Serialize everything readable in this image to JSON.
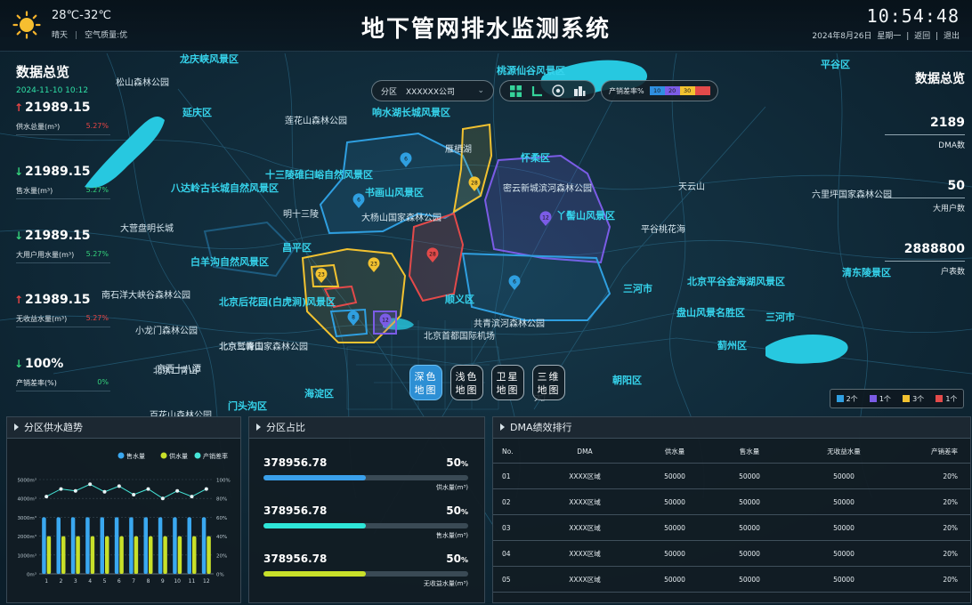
{
  "header": {
    "temperature": "28℃-32℃",
    "weather": "晴天",
    "air_quality": "空气质量:优",
    "title": "地下管网排水监测系统",
    "clock": "10:54:48",
    "date": "2024年8月26日",
    "weekday": "星期一",
    "back_label": "返回",
    "exit_label": "退出",
    "sun_icon": "sun-icon"
  },
  "left_panel": {
    "title": "数据总览",
    "date": "2024-11-10 10:12",
    "stats": [
      {
        "value": "21989.15",
        "label": "供水总量(m³)",
        "pct": "5.27%",
        "trend": "up"
      },
      {
        "value": "21989.15",
        "label": "售水量(m³)",
        "pct": "5.27%",
        "trend": "down"
      },
      {
        "value": "21989.15",
        "label": "大用户用水量(m³)",
        "pct": "5.27%",
        "trend": "down"
      },
      {
        "value": "21989.15",
        "label": "无收益水量(m³)",
        "pct": "5.27%",
        "trend": "up"
      },
      {
        "value": "100%",
        "label": "产销差率(%)",
        "pct": "0%",
        "trend": "down"
      }
    ]
  },
  "right_panel": {
    "title": "数据总览",
    "stats": [
      {
        "value": "2189",
        "label": "DMA数"
      },
      {
        "value": "50",
        "label": "大用户数"
      },
      {
        "value": "2888800",
        "label": "户表数"
      }
    ]
  },
  "toolbar": {
    "district_label": "分区",
    "district_value": "XXXXXX公司",
    "ratio_label": "产销差率%",
    "ratio_scale": [
      {
        "label": "10",
        "color": "#2f8fe0"
      },
      {
        "label": "20",
        "color": "#7b5ce6"
      },
      {
        "label": "30",
        "color": "#f2c230"
      },
      {
        "label": "",
        "color": "#e34a4a"
      }
    ]
  },
  "map": {
    "labels": [
      "龙庆峡风景区",
      "松山森林公园",
      "延庆区",
      "莲花山森林公园",
      "响水湖长城风景区",
      "桃源仙谷风景区",
      "怀柔区",
      "平谷区",
      "雁栖湖",
      "十三陵碓臼峪自然风景区",
      "八达岭古长城自然风景区",
      "书画山风景区",
      "密云新城滨河森林公园",
      "天云山",
      "大杨山国家森林公园",
      "丫髻山风景区",
      "明十三陵",
      "昌平区",
      "六里坪国家森林公园",
      "大营盘明长城",
      "平谷桃花海",
      "白羊沟自然风景区",
      "顺义区",
      "北京平谷金海湖风景区",
      "清东陵景区",
      "南石洋大峡谷森林公园",
      "北京后花园(白虎涧)风景区",
      "共青滨河森林公园",
      "北京首都国际机场",
      "盘山风景名胜区",
      "小龙门森林公园",
      "北京鹫峰国家森林公园",
      "北京二青山",
      "百花山森林公园",
      "门头沟区",
      "海淀区",
      "朝阳区",
      "大厂",
      "蓟州区",
      "三河市",
      "京西十八潭",
      "北京二青山",
      "三河市",
      "京西十八潭",
      "北京二青山"
    ],
    "markers": [
      "6",
      "6",
      "28",
      "12",
      "23",
      "23",
      "28",
      "8",
      "12",
      "6"
    ],
    "style_buttons": [
      {
        "label_top": "深色",
        "label_bottom": "地图",
        "active": true
      },
      {
        "label_top": "浅色",
        "label_bottom": "地图",
        "active": false
      },
      {
        "label_top": "卫星",
        "label_bottom": "地图",
        "active": false
      },
      {
        "label_top": "三维",
        "label_bottom": "地图",
        "active": false
      }
    ],
    "count_legend": [
      {
        "color": "#2f9fe0",
        "label": "2个"
      },
      {
        "color": "#7b5ce6",
        "label": "1个"
      },
      {
        "color": "#f2c230",
        "label": "3个"
      },
      {
        "color": "#e34a4a",
        "label": "1个"
      }
    ]
  },
  "panels": {
    "trend_title": "分区供水趋势",
    "proportion_title": "分区占比",
    "ranking_title": "DMA绩效排行"
  },
  "chart_data": {
    "type": "bar",
    "title": "分区供水趋势",
    "categories": [
      "1",
      "2",
      "3",
      "4",
      "5",
      "6",
      "7",
      "8",
      "9",
      "10",
      "11",
      "12"
    ],
    "series": [
      {
        "name": "售水量",
        "type": "bar",
        "color": "#3aa8f0",
        "values": [
          3000,
          3000,
          3000,
          3000,
          3000,
          3000,
          3000,
          3000,
          3000,
          3000,
          3000,
          3000
        ]
      },
      {
        "name": "供水量",
        "type": "bar",
        "color": "#c8e02a",
        "values": [
          2000,
          2000,
          2000,
          2000,
          2000,
          2000,
          2000,
          2000,
          2000,
          2000,
          2000,
          2000
        ]
      },
      {
        "name": "产销差率",
        "type": "line",
        "color": "#46e6d8",
        "axis": "right",
        "values": [
          82,
          90,
          88,
          95,
          87,
          93,
          84,
          90,
          80,
          88,
          82,
          90
        ]
      }
    ],
    "left_ticks": [
      "0m³",
      "1000m³",
      "2000m³",
      "3000m³",
      "4000m³",
      "5000m³"
    ],
    "right_ticks": [
      "0%",
      "20%",
      "40%",
      "60%",
      "80%",
      "100%"
    ],
    "ylim_left": [
      0,
      5000
    ],
    "ylim_right": [
      0,
      100
    ],
    "legend_position": "top-right",
    "grid": true
  },
  "proportion": [
    {
      "value": "378956.78",
      "pct": "50",
      "pct_unit": "%",
      "fill": 0.5,
      "label": "供水量(m³)",
      "color": "#3aa0ea"
    },
    {
      "value": "378956.78",
      "pct": "50",
      "pct_unit": "%",
      "fill": 0.5,
      "label": "售水量(m³)",
      "color": "#2ee6d8"
    },
    {
      "value": "378956.78",
      "pct": "50",
      "pct_unit": "%",
      "fill": 0.5,
      "label": "无收益水量(m³)",
      "color": "#c8e02a"
    }
  ],
  "ranking_table": {
    "headers": [
      "No.",
      "DMA",
      "供水量",
      "售水量",
      "无收益水量",
      "产销差率"
    ],
    "rows": [
      [
        "01",
        "XXXX区域",
        "50000",
        "50000",
        "50000",
        "20%"
      ],
      [
        "02",
        "XXXX区域",
        "50000",
        "50000",
        "50000",
        "20%"
      ],
      [
        "03",
        "XXXX区域",
        "50000",
        "50000",
        "50000",
        "20%"
      ],
      [
        "04",
        "XXXX区域",
        "50000",
        "50000",
        "50000",
        "20%"
      ],
      [
        "05",
        "XXXX区域",
        "50000",
        "50000",
        "50000",
        "20%"
      ]
    ]
  }
}
